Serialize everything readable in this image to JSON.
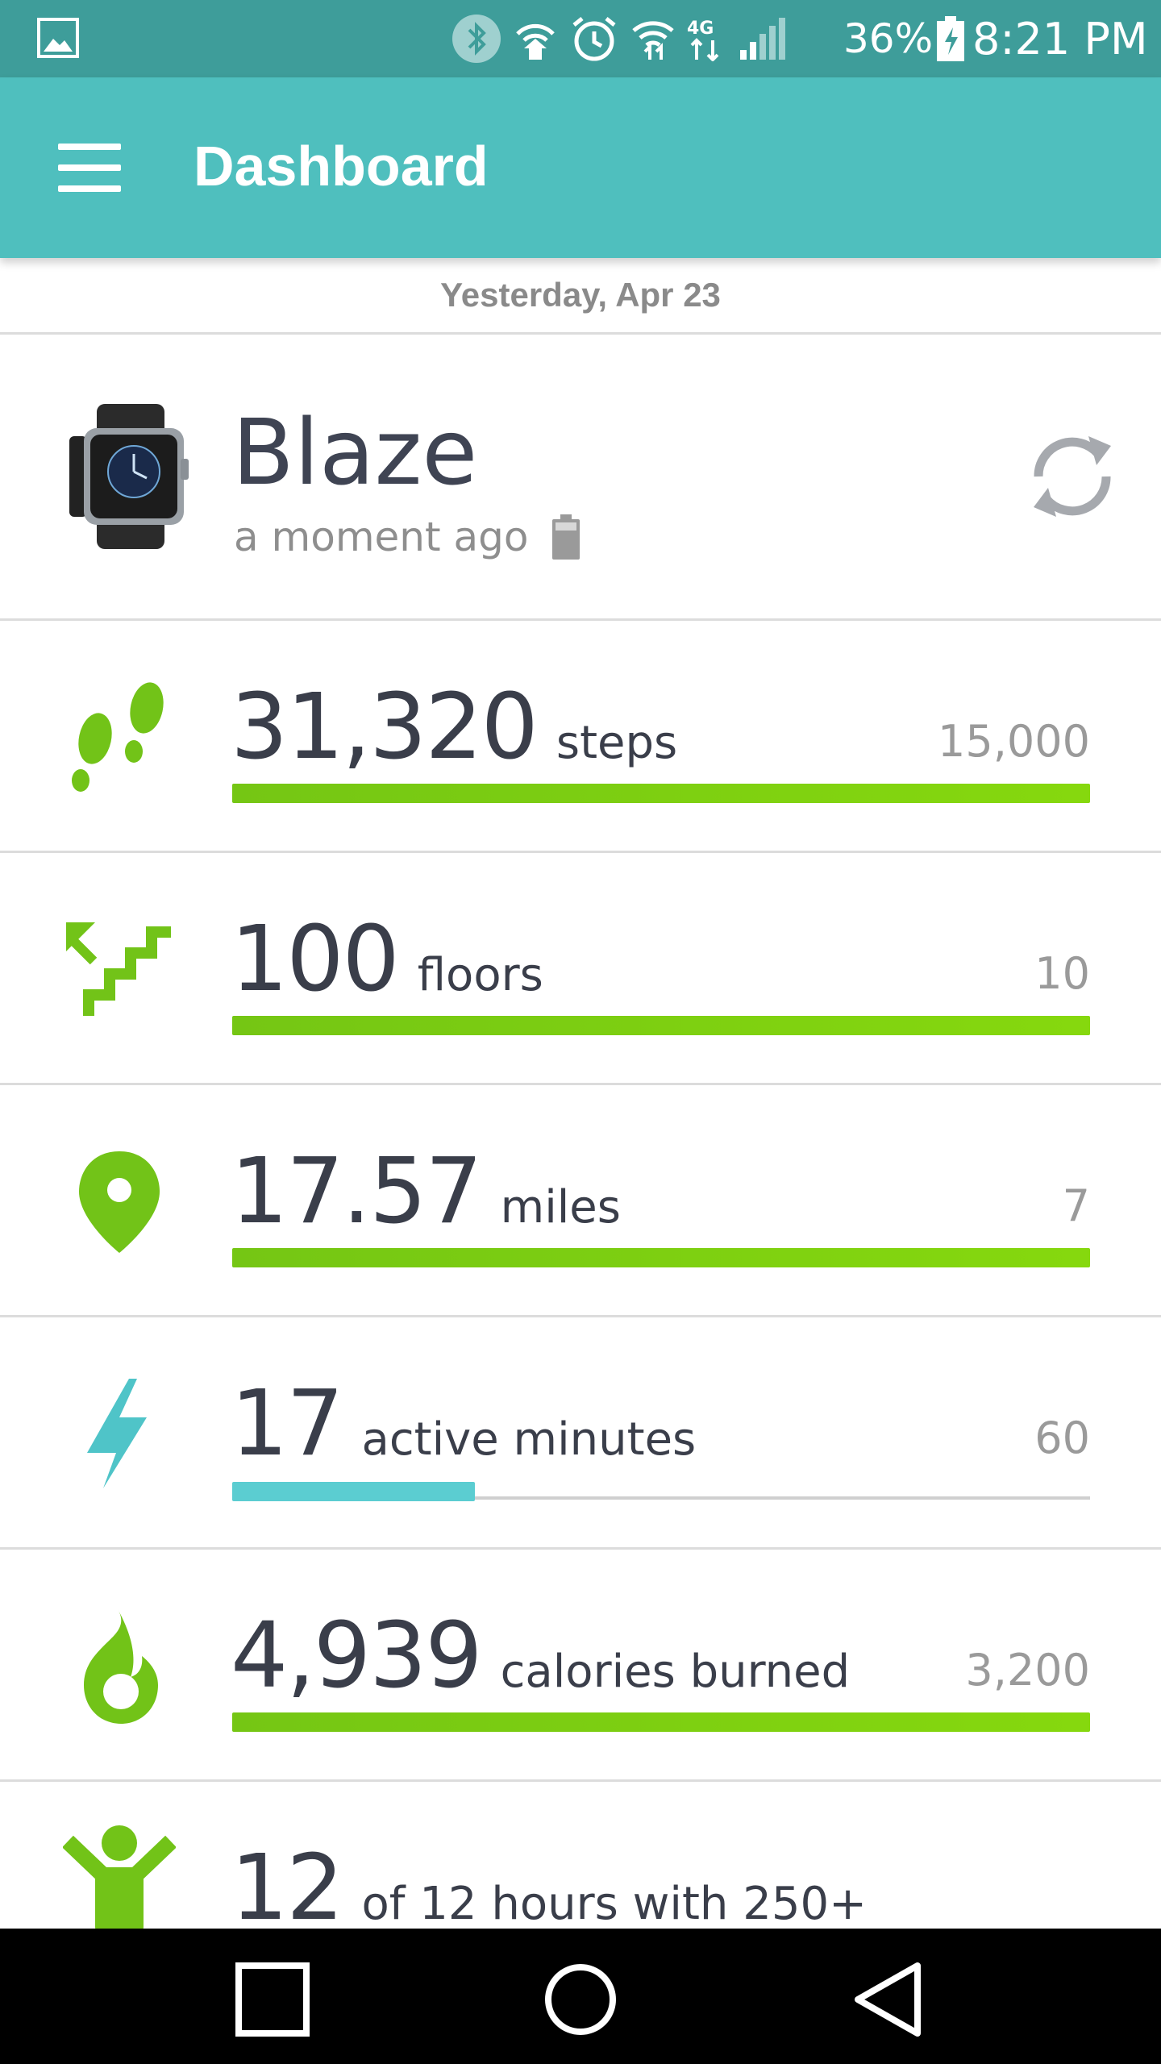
{
  "status_bar": {
    "network": "4G LTE",
    "battery_percent": "36%",
    "time": "8:21 PM"
  },
  "app_bar": {
    "title": "Dashboard"
  },
  "date_header": "Yesterday, Apr 23",
  "device": {
    "name": "Blaze",
    "last_sync": "a moment ago"
  },
  "stats": {
    "steps": {
      "value": "31,320",
      "unit": "steps",
      "goal": "15,000",
      "progress": 1.0
    },
    "floors": {
      "value": "100",
      "unit": "floors",
      "goal": "10",
      "progress": 1.0
    },
    "distance": {
      "value": "17.57",
      "unit": "miles",
      "goal": "7",
      "progress": 1.0
    },
    "active_minutes": {
      "value": "17",
      "unit": "active minutes",
      "goal": "60",
      "progress": 0.283
    },
    "calories": {
      "value": "4,939",
      "unit": "calories burned",
      "goal": "3,200",
      "progress": 1.0
    },
    "hourly_activity": {
      "value": "12",
      "unit": "of 12 hours with 250+"
    }
  },
  "colors": {
    "status_bar": "#3e9d9a",
    "app_bar": "#4fbfbe",
    "progress_green": "#7ccf10",
    "progress_teal": "#5bcdd1",
    "icon_green": "#72c318",
    "icon_teal": "#4fc4c8"
  },
  "icons": {
    "menu": "hamburger-menu-icon",
    "sync": "sync-icon",
    "steps": "footprints-icon",
    "floors": "stairs-icon",
    "distance": "location-pin-icon",
    "active_minutes": "lightning-bolt-icon",
    "calories": "flame-icon",
    "hourly_activity": "person-icon"
  }
}
